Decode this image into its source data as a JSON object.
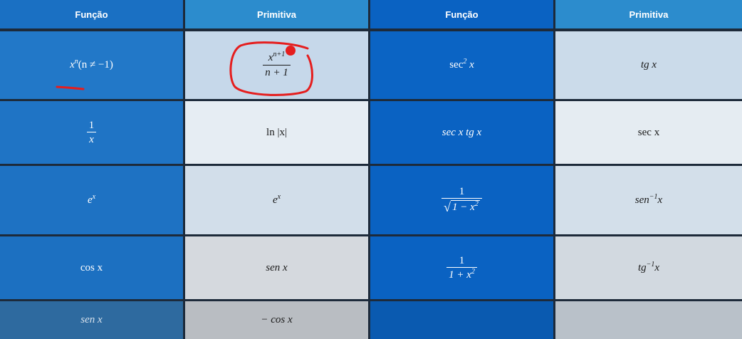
{
  "headers": [
    "Função",
    "Primitiva",
    "Função",
    "Primitiva"
  ],
  "rows": [
    {
      "f1": {
        "base": "x",
        "sup": "n",
        "cond": "(n ≠ −1)"
      },
      "p1": {
        "num_base": "x",
        "num_sup": "n+1",
        "den": "n + 1"
      },
      "f2": {
        "base": "sec",
        "sup": "2",
        "arg": "x"
      },
      "p2": {
        "text": "tg x"
      }
    },
    {
      "f1": {
        "num": "1",
        "den": "x"
      },
      "p1": {
        "text": "ln |x|"
      },
      "f2": {
        "text": "sec x tg x"
      },
      "p2": {
        "text": "sec x"
      }
    },
    {
      "f1": {
        "base": "e",
        "sup": "x"
      },
      "p1": {
        "base": "e",
        "sup": "x"
      },
      "f2": {
        "num": "1",
        "rad": "√",
        "den_a": "1 − x",
        "den_sup": "2"
      },
      "p2": {
        "base": "sen",
        "sup": "−1",
        "arg": "x"
      }
    },
    {
      "f1": {
        "text": "cos x"
      },
      "p1": {
        "text": "sen x"
      },
      "f2": {
        "num": "1",
        "den_a": "1 + x",
        "den_sup": "2"
      },
      "p2": {
        "base": "tg",
        "sup": "−1",
        "arg": "x"
      }
    },
    {
      "f1": {
        "text": "sen x"
      },
      "p1": {
        "text": "− cos x"
      },
      "f2": {
        "text": ""
      },
      "p2": {
        "text": ""
      }
    }
  ],
  "colors": {
    "col1": "#1f74c6",
    "col2_header": "#2e8fcf",
    "col3": "#0a62c2",
    "col4_header": "#2e8fcf",
    "annotation": "#e51e1e"
  }
}
